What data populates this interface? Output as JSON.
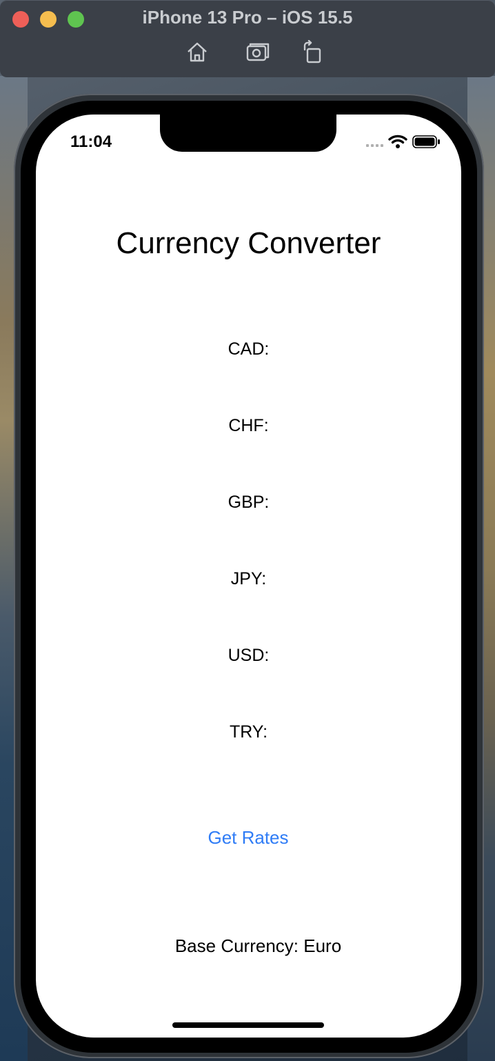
{
  "simulator": {
    "title": "iPhone 13 Pro – iOS 15.5",
    "toolbar_icons": [
      "home-icon",
      "screenshot-icon",
      "rotate-icon"
    ]
  },
  "status_bar": {
    "time": "11:04",
    "icons": [
      "cellular-signal-icon",
      "wifi-icon",
      "battery-icon"
    ]
  },
  "app": {
    "title": "Currency Converter",
    "rates": [
      {
        "label": "CAD:"
      },
      {
        "label": "CHF:"
      },
      {
        "label": "GBP:"
      },
      {
        "label": "JPY:"
      },
      {
        "label": "USD:"
      },
      {
        "label": "TRY:"
      }
    ],
    "get_rates_label": "Get Rates",
    "base_currency_text": "Base Currency: Euro"
  },
  "colors": {
    "accent": "#2f7cf6",
    "close": "#ee5f58",
    "minimize": "#f5bd4f",
    "maximize": "#5fc450"
  }
}
